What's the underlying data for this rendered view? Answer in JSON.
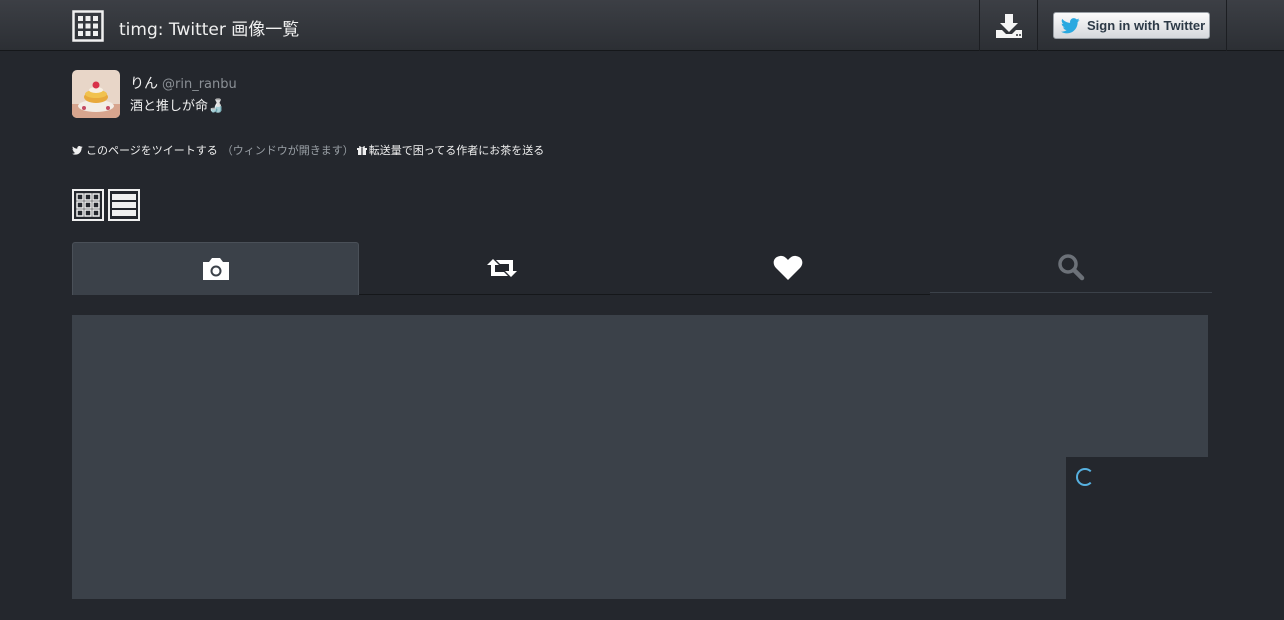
{
  "navbar": {
    "title": "timg: Twitter 画像一覧",
    "logo_icon": "grid-icon",
    "download_icon": "download-icon",
    "signin_label": "Sign in with Twitter",
    "signin_icon": "twitter-bird-icon"
  },
  "profile": {
    "name": "りん",
    "handle": "@rin_ranbu",
    "bio": "酒と推しが命🍶"
  },
  "share": {
    "tweet_label": "このページをツイートする",
    "tweet_note": "（ウィンドウが開きます）",
    "gift_label": "転送量で困ってる作者にお茶を送る"
  },
  "view_toggles": [
    {
      "icon": "grid-view-icon"
    },
    {
      "icon": "list-view-icon"
    }
  ],
  "tabs": [
    {
      "icon": "camera-icon",
      "active": true
    },
    {
      "icon": "retweet-icon",
      "active": false
    },
    {
      "icon": "heart-icon",
      "active": false
    },
    {
      "icon": "search-icon",
      "active": false
    }
  ],
  "colors": {
    "background": "#24272d",
    "tile": "#3b4149",
    "spinner": "#57b1e0"
  }
}
